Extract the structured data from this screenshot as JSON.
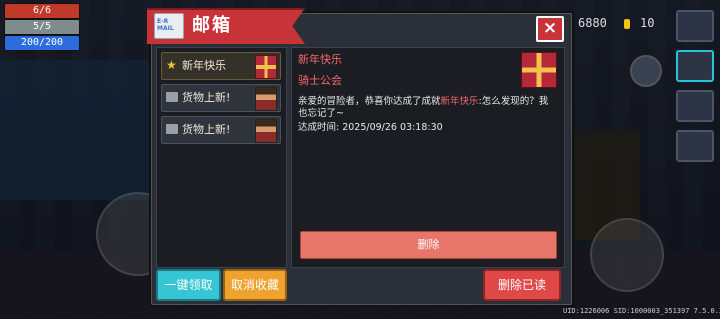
{
  "hud": {
    "hp": "6/6",
    "armor": "5/5",
    "energy": "200/200",
    "gems": "6880",
    "coins": "10"
  },
  "colors": {
    "hp_bar": "#c0392b",
    "armor_bar": "#7f8c8d",
    "energy_bar": "#2d6cdf",
    "ribbon": "#c8333a",
    "highlight_text": "#f06a6a",
    "delete_button": "#e8756a",
    "claim_all_button": "#36c5d3",
    "unfavorite_button": "#f0a22e",
    "delete_read_button": "#e04848"
  },
  "modal": {
    "title": "邮箱",
    "logo_text": "E-R MAIL",
    "close_label": "×"
  },
  "mail_list": [
    {
      "label": "新年快乐",
      "icon": "star-icon",
      "selected": true
    },
    {
      "label": "货物上新!",
      "icon": "envelope-icon",
      "selected": false
    },
    {
      "label": "货物上新!",
      "icon": "envelope-icon",
      "selected": false
    }
  ],
  "detail": {
    "title": "新年快乐",
    "sender": "骑士公会",
    "body_prefix": "亲爱的冒险者，恭喜你达成了成就",
    "body_highlight": "新年快乐",
    "body_suffix": ":怎么发现的？我也忘记了~",
    "time": "达成时间: 2025/09/26 03:18:30",
    "delete_label": "删除"
  },
  "buttons": {
    "claim_all": "一键领取",
    "unfavorite": "取消收藏",
    "delete_read": "删除已读"
  },
  "footer": "UID:1226006 SID:1000003_351397 7.5.0.37"
}
